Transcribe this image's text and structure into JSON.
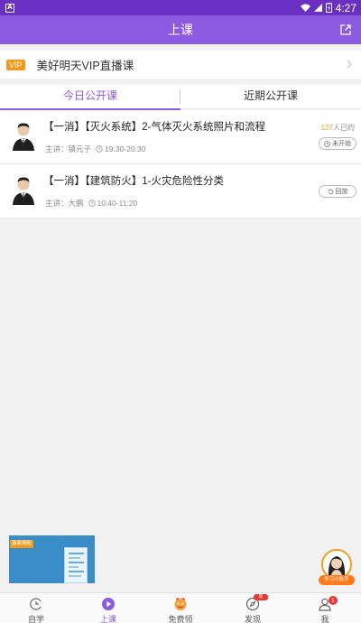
{
  "statusbar": {
    "time": "4:27"
  },
  "header": {
    "title": "上课"
  },
  "vip": {
    "badge": "VIP",
    "title": "美好明天VIP直播课"
  },
  "tabs": [
    {
      "label": "今日公开课",
      "active": true
    },
    {
      "label": "近期公开课",
      "active": false
    }
  ],
  "courses": [
    {
      "title": "【一消】【灭火系统】2-气体灭火系统照片和流程",
      "teacher": "主讲：镇元子",
      "time": "19:30-20:30",
      "booked_count": "127",
      "booked_suffix": "人已约",
      "action": "未开始"
    },
    {
      "title": "【一消】【建筑防火】1-火灾危险性分类",
      "teacher": "主讲：大鹏",
      "time": "10:40-11:20",
      "action": "回放"
    }
  ],
  "float_video": {
    "tag": "独家揭秘"
  },
  "float_helper": {
    "label": "学习小助手"
  },
  "nav": [
    {
      "label": "自学",
      "icon": "study-icon",
      "active": false
    },
    {
      "label": "上课",
      "icon": "play-icon",
      "active": true
    },
    {
      "label": "免费领",
      "icon": "gift-icon",
      "active": false
    },
    {
      "label": "发现",
      "icon": "compass-icon",
      "active": false,
      "badge": "新"
    },
    {
      "label": "我",
      "icon": "user-icon",
      "active": false,
      "badge": "1"
    }
  ],
  "colors": {
    "accent": "#8c5ae0",
    "statusbar": "#6a2fc3",
    "orange": "#f39a1c"
  }
}
